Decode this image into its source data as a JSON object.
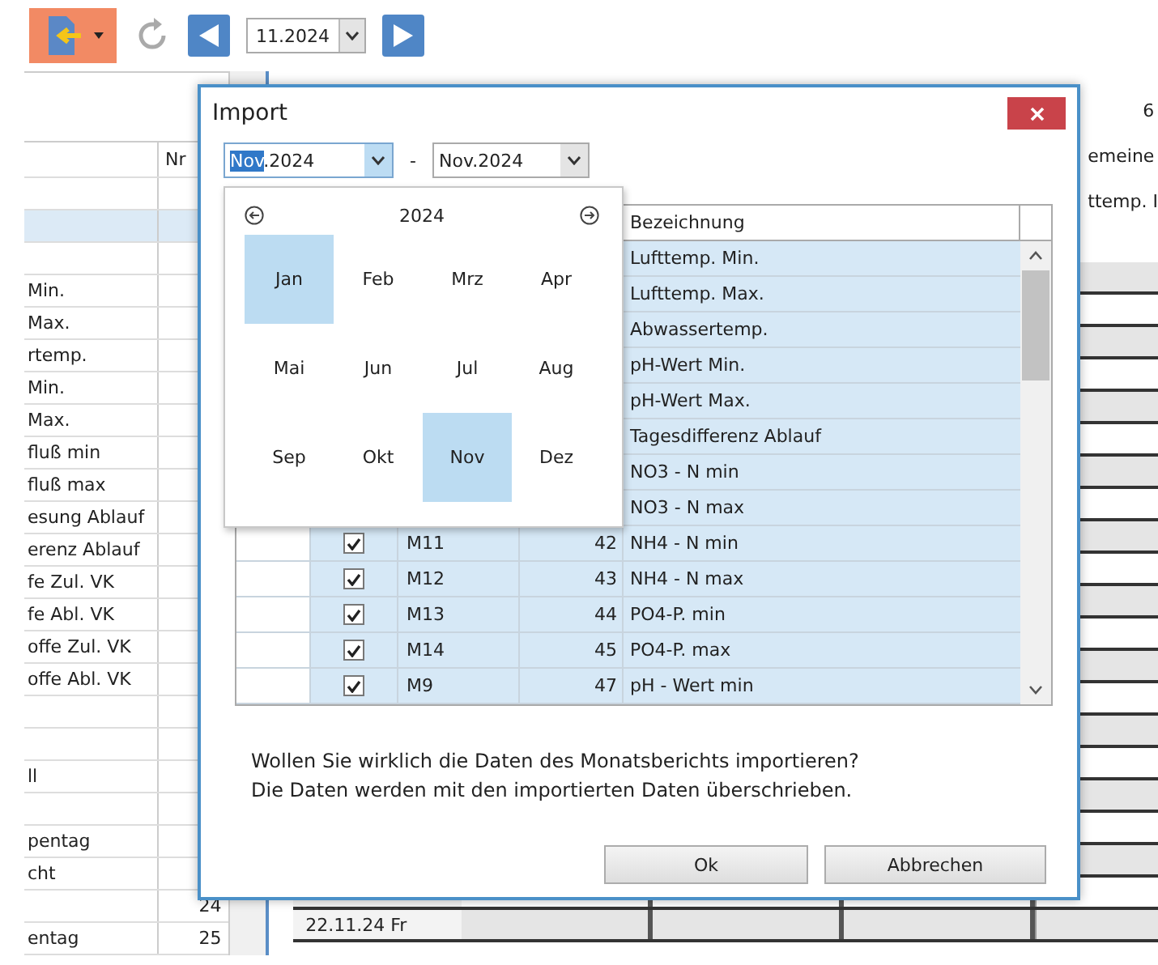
{
  "toolbar": {
    "period": "11.2024"
  },
  "left_table": {
    "columns": [
      "Nr"
    ],
    "rows": [
      {
        "name": "",
        "nr": "",
        "selected": false
      },
      {
        "name": "",
        "nr": "",
        "selected": true
      },
      {
        "name": "",
        "nr": "",
        "selected": false
      },
      {
        "name": "Min.",
        "nr": "",
        "selected": false
      },
      {
        "name": "Max.",
        "nr": "",
        "selected": false
      },
      {
        "name": "rtemp.",
        "nr": "",
        "selected": false
      },
      {
        "name": "Min.",
        "nr": "",
        "selected": false
      },
      {
        "name": "Max.",
        "nr": "",
        "selected": false
      },
      {
        "name": "fluß min",
        "nr": "",
        "selected": false
      },
      {
        "name": "fluß max",
        "nr": "",
        "selected": false
      },
      {
        "name": "esung Ablauf",
        "nr": "",
        "selected": false
      },
      {
        "name": "erenz Ablauf",
        "nr": "",
        "selected": false
      },
      {
        "name": "fe Zul. VK",
        "nr": "",
        "selected": false
      },
      {
        "name": "fe Abl. VK",
        "nr": "",
        "selected": false
      },
      {
        "name": "offe Zul. VK",
        "nr": "",
        "selected": false
      },
      {
        "name": "offe Abl. VK",
        "nr": "",
        "selected": false
      },
      {
        "name": "",
        "nr": "",
        "selected": false
      },
      {
        "name": "",
        "nr": "",
        "selected": false
      },
      {
        "name": "ll",
        "nr": "",
        "selected": false
      },
      {
        "name": "",
        "nr": "",
        "selected": false
      },
      {
        "name": "pentag",
        "nr": "",
        "selected": false
      },
      {
        "name": "cht",
        "nr": "",
        "selected": false
      },
      {
        "name": "",
        "nr": "24",
        "selected": false
      },
      {
        "name": "entag",
        "nr": "25",
        "selected": false
      }
    ]
  },
  "right_grid": {
    "headers": [
      "6",
      "emeine",
      "ttemp. I"
    ],
    "dates": [
      "22.11.24 Fr"
    ]
  },
  "dialog": {
    "title": "Import",
    "from": {
      "highlighted": "Nov",
      "rest": ".2024"
    },
    "separator": "-",
    "to": "Nov.2024",
    "calendar": {
      "year": "2024",
      "months": [
        {
          "label": "Jan",
          "selected": true
        },
        {
          "label": "Feb",
          "selected": false
        },
        {
          "label": "Mrz",
          "selected": false
        },
        {
          "label": "Apr",
          "selected": false
        },
        {
          "label": "Mai",
          "selected": false
        },
        {
          "label": "Jun",
          "selected": false
        },
        {
          "label": "Jul",
          "selected": false
        },
        {
          "label": "Aug",
          "selected": false
        },
        {
          "label": "Sep",
          "selected": false
        },
        {
          "label": "Okt",
          "selected": false
        },
        {
          "label": "Nov",
          "selected": true
        },
        {
          "label": "Dez",
          "selected": false
        }
      ]
    },
    "table": {
      "columns": [
        "Bezeichnung"
      ],
      "rows": [
        {
          "name": "Lufttemp. Min.",
          "selected": true
        },
        {
          "name": "Lufttemp. Max.",
          "selected": true
        },
        {
          "name": "Abwassertemp.",
          "selected": true
        },
        {
          "name": "pH-Wert Min.",
          "selected": true
        },
        {
          "name": "pH-Wert Max.",
          "selected": true
        },
        {
          "name": "Tagesdifferenz Ablauf",
          "selected": true
        },
        {
          "name": "NO3 - N min",
          "selected": true
        },
        {
          "name": "NO3 - N max",
          "selected": true
        },
        {
          "checked": true,
          "code": "M11",
          "nr": "42",
          "name": "NH4 - N min",
          "selected": true
        },
        {
          "checked": true,
          "code": "M12",
          "nr": "43",
          "name": "NH4 - N max",
          "selected": true
        },
        {
          "checked": true,
          "code": "M13",
          "nr": "44",
          "name": "PO4-P. min",
          "selected": true
        },
        {
          "checked": true,
          "code": "M14",
          "nr": "45",
          "name": "PO4-P. max",
          "selected": true
        },
        {
          "checked": true,
          "code": "M9",
          "nr": "47",
          "name": "pH - Wert min",
          "selected": true
        }
      ]
    },
    "message": [
      "Wollen Sie wirklich die Daten des Monatsberichts importieren?",
      "Die Daten werden mit den importierten Daten überschrieben."
    ],
    "buttons": [
      "Ok",
      "Abbrechen"
    ]
  }
}
